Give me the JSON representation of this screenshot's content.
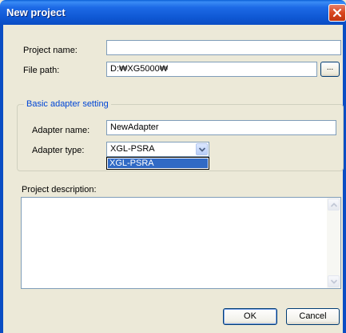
{
  "window": {
    "title": "New project"
  },
  "form": {
    "project_name_label": "Project name:",
    "project_name_value": "",
    "file_path_label": "File path:",
    "file_path_value": "D:₩XG5000₩",
    "browse_label": "..."
  },
  "adapter": {
    "group_label": "Basic adapter setting",
    "name_label": "Adapter name:",
    "name_value": "NewAdapter",
    "type_label": "Adapter type:",
    "type_value": "XGL-PSRA",
    "type_options": [
      "XGL-PSRA"
    ]
  },
  "description": {
    "label": "Project description:",
    "value": ""
  },
  "buttons": {
    "ok": "OK",
    "cancel": "Cancel"
  },
  "colors": {
    "titlebar": "#0a5fd6",
    "close": "#d9471f",
    "selection": "#316ac5",
    "group_label": "#0046d5",
    "dialog_bg": "#ece9d8"
  }
}
